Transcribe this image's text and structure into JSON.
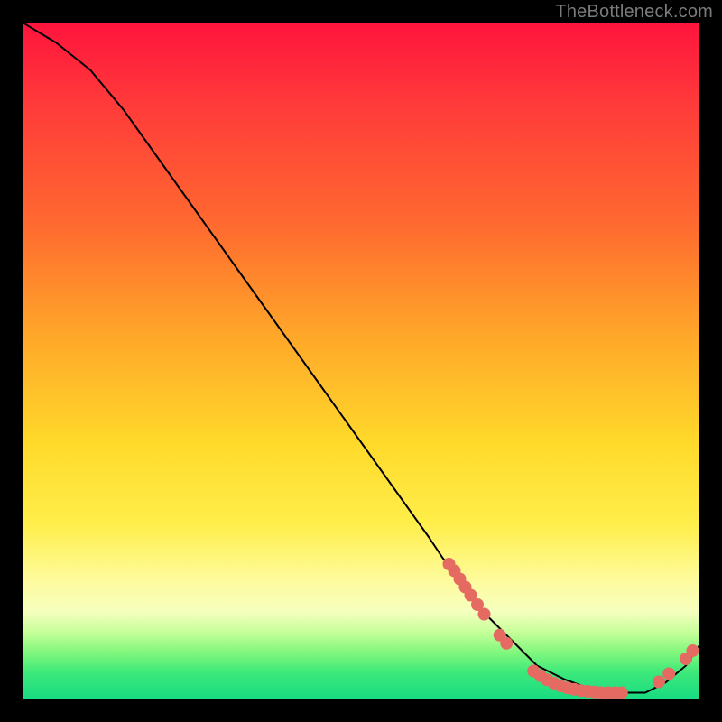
{
  "watermark": "TheBottleneck.com",
  "chart_data": {
    "type": "line",
    "title": "",
    "xlabel": "",
    "ylabel": "",
    "xlim": [
      0,
      100
    ],
    "ylim": [
      0,
      100
    ],
    "grid": false,
    "series": [
      {
        "name": "curve",
        "x": [
          0,
          5,
          10,
          15,
          20,
          25,
          30,
          35,
          40,
          45,
          50,
          55,
          60,
          62,
          65,
          68,
          72,
          76,
          80,
          84,
          88,
          92,
          95,
          98,
          100
        ],
        "y": [
          100,
          97,
          93,
          87,
          80,
          73,
          66,
          59,
          52,
          45,
          38,
          31,
          24,
          21,
          17,
          13,
          9,
          5,
          3,
          1.5,
          1,
          1,
          2.5,
          5,
          8
        ],
        "color": "#000000",
        "linewidth": 2
      }
    ],
    "markers": [
      {
        "name": "entry-dense-1",
        "x": 63.0,
        "y": 20.0
      },
      {
        "name": "entry-dense-2",
        "x": 63.8,
        "y": 19.0
      },
      {
        "name": "entry-dense-3",
        "x": 64.6,
        "y": 17.8
      },
      {
        "name": "entry-dense-4",
        "x": 65.4,
        "y": 16.6
      },
      {
        "name": "entry-dense-5",
        "x": 66.2,
        "y": 15.4
      },
      {
        "name": "entry-dense-6",
        "x": 67.2,
        "y": 14.0
      },
      {
        "name": "entry-dense-7",
        "x": 68.2,
        "y": 12.6
      },
      {
        "name": "entry-gap-1",
        "x": 70.5,
        "y": 9.5
      },
      {
        "name": "entry-gap-2",
        "x": 71.5,
        "y": 8.3
      },
      {
        "name": "bottom-1",
        "x": 75.5,
        "y": 4.2
      },
      {
        "name": "bottom-2",
        "x": 76.5,
        "y": 3.5
      },
      {
        "name": "bottom-3",
        "x": 77.5,
        "y": 2.9
      },
      {
        "name": "bottom-4",
        "x": 78.5,
        "y": 2.4
      },
      {
        "name": "bottom-5",
        "x": 79.5,
        "y": 2.0
      },
      {
        "name": "bottom-6",
        "x": 80.5,
        "y": 1.7
      },
      {
        "name": "bottom-7",
        "x": 81.5,
        "y": 1.5
      },
      {
        "name": "bottom-8",
        "x": 82.5,
        "y": 1.3
      },
      {
        "name": "bottom-9",
        "x": 83.5,
        "y": 1.2
      },
      {
        "name": "bottom-10",
        "x": 84.5,
        "y": 1.1
      },
      {
        "name": "bottom-11",
        "x": 85.5,
        "y": 1.0
      },
      {
        "name": "bottom-12",
        "x": 86.5,
        "y": 1.0
      },
      {
        "name": "bottom-13",
        "x": 87.5,
        "y": 1.0
      },
      {
        "name": "bottom-14",
        "x": 88.5,
        "y": 1.0
      },
      {
        "name": "exit-1",
        "x": 94.0,
        "y": 2.6
      },
      {
        "name": "exit-2",
        "x": 95.5,
        "y": 3.8
      },
      {
        "name": "exit-3",
        "x": 98.0,
        "y": 6.0
      },
      {
        "name": "exit-4",
        "x": 99.0,
        "y": 7.2
      }
    ],
    "marker_style": {
      "color": "#e46a62",
      "radius": 7
    }
  }
}
